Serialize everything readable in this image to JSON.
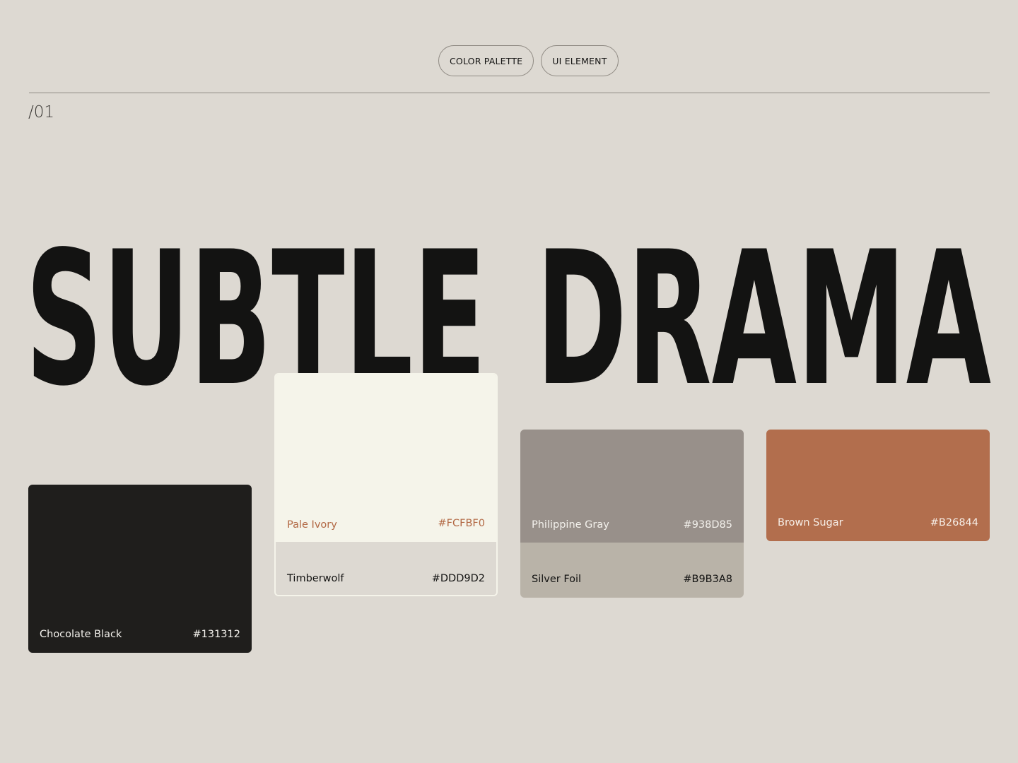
{
  "tags": {
    "color_palette": "COLOR PALETTE",
    "ui_element": "UI ELEMENT"
  },
  "section_number": "/01",
  "headline": {
    "word1": "SUBTLE",
    "word2": "DRAMA"
  },
  "swatches": {
    "chocolate_black": {
      "name": "Chocolate Black",
      "hex": "#131312"
    },
    "pale_ivory": {
      "name": "Pale Ivory",
      "hex": "#FCFBF0"
    },
    "timberwolf": {
      "name": "Timberwolf",
      "hex": "#DDD9D2"
    },
    "philippine_gray": {
      "name": "Philippine Gray",
      "hex": "#938D85"
    },
    "silver_foil": {
      "name": "Silver Foil",
      "hex": "#B9B3A8"
    },
    "brown_sugar": {
      "name": "Brown Sugar",
      "hex": "#B26844"
    }
  }
}
